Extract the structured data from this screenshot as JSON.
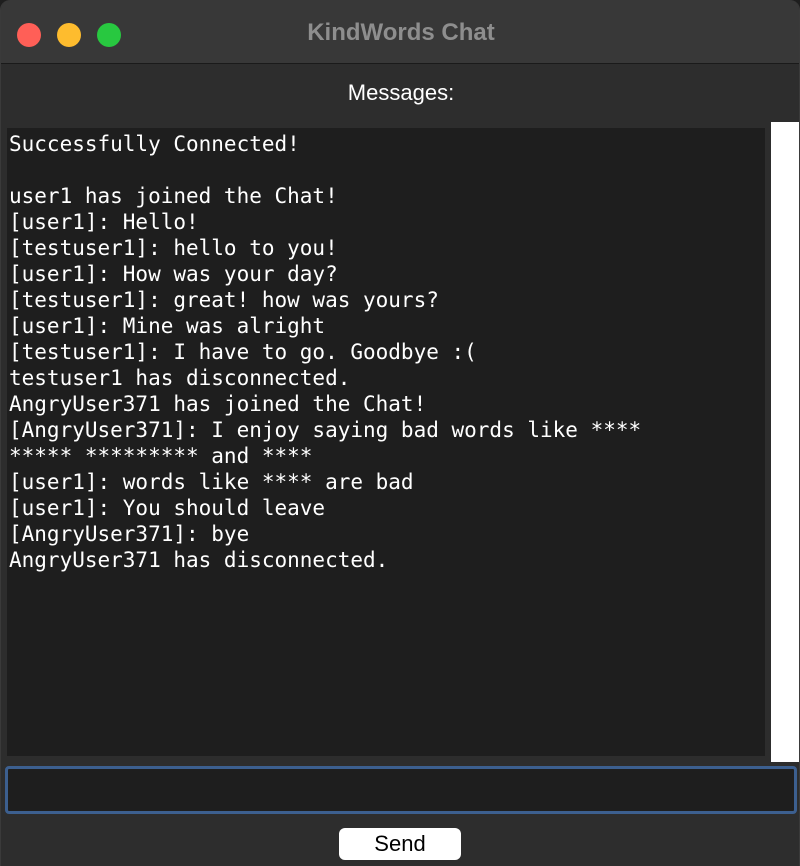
{
  "window": {
    "title": "KindWords Chat"
  },
  "chat": {
    "label": "Messages:",
    "lines": [
      "Successfully Connected!",
      "",
      "user1 has joined the Chat!",
      "[user1]: Hello!",
      "[testuser1]: hello to you!",
      "[user1]: How was your day?",
      "[testuser1]: great! how was yours?",
      "[user1]: Mine was alright",
      "[testuser1]: I have to go. Goodbye :(",
      "testuser1 has disconnected.",
      "AngryUser371 has joined the Chat!",
      "[AngryUser371]: I enjoy saying bad words like ****",
      "***** ********* and ****",
      "[user1]: words like **** are bad",
      "[user1]: You should leave",
      "[AngryUser371]: bye",
      "AngryUser371 has disconnected."
    ]
  },
  "input": {
    "value": ""
  },
  "send_button": {
    "label": "Send"
  },
  "colors": {
    "close": "#ff5f57",
    "minimize": "#febc2e",
    "zoom": "#28c840",
    "input_border": "#3c5f8f"
  }
}
